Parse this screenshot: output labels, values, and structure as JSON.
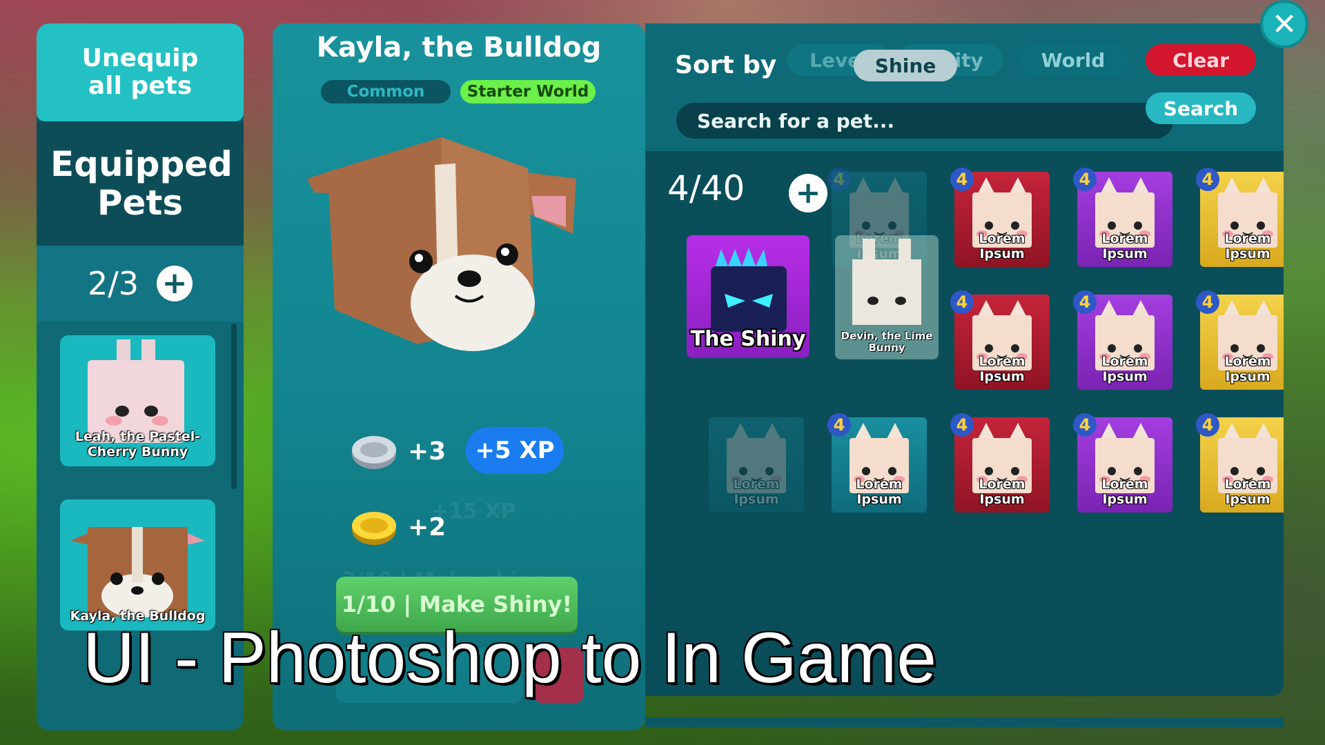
{
  "caption": "UI - Photoshop to In Game",
  "left_panel": {
    "unequip_label": "Unequip all pets",
    "equipped_title": "Equipped Pets",
    "equipped_count": "2/3",
    "add_symbol": "+",
    "equipped_pets": [
      {
        "name": "Leah, the Pastel-Cherry Bunny"
      },
      {
        "name": "Kayla, the Bulldog"
      }
    ]
  },
  "detail": {
    "pet_name": "Kayla, the Bulldog",
    "rarity": "Common",
    "world": "Starter World",
    "stat_silver": "+3",
    "stat_xp": "+5 XP",
    "stat_gold": "+2",
    "ghost_xp": "+15 XP",
    "ghost_make_shine": "3/10 | Make shine",
    "make_shiny_button": "1/10 | Make Shiny!"
  },
  "inventory": {
    "sort_by_label": "Sort by",
    "sort_options": {
      "level": "Level",
      "shine": "Shine",
      "rarity": "Rarity",
      "world": "World",
      "clear": "Clear"
    },
    "search_placeholder": "Search for a pet...",
    "search_button": "Search",
    "count": "4/40",
    "add_symbol": "+",
    "featured_pet": "The Shiny",
    "dragged_pet": "Devin, the Lime Bunny",
    "tile_label": "Lorem Ipsum",
    "level_badge": "4",
    "colors": {
      "red": "#c5243a",
      "purple": "#a43ee0",
      "yellow": "#f3d24a",
      "teal": "#1a8fa0"
    }
  },
  "close_symbol": "✕"
}
